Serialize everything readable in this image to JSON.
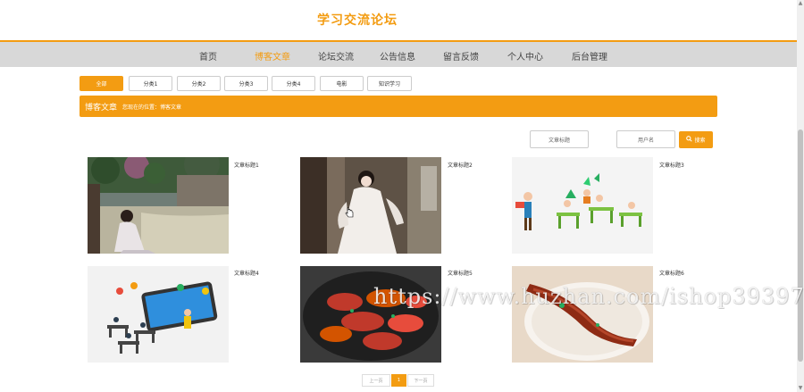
{
  "site": {
    "title": "学习交流论坛"
  },
  "nav": {
    "items": [
      {
        "label": "首页"
      },
      {
        "label": "博客文章"
      },
      {
        "label": "论坛交流"
      },
      {
        "label": "公告信息"
      },
      {
        "label": "留言反馈"
      },
      {
        "label": "个人中心"
      },
      {
        "label": "后台管理"
      }
    ],
    "active_index": 1
  },
  "categories": [
    "全部",
    "分类1",
    "分类2",
    "分类3",
    "分类4",
    "电影",
    "知识学习"
  ],
  "active_category": 0,
  "banner": {
    "title": "博客文章",
    "breadcrumb": "您现在的位置：博客文章"
  },
  "search": {
    "title_placeholder": "文章标题",
    "user_placeholder": "用户名",
    "button_label": "搜索"
  },
  "articles": [
    {
      "title": "文章标题1",
      "image": "woman-by-river-photo"
    },
    {
      "title": "文章标题2",
      "image": "woman-hanfu-photo"
    },
    {
      "title": "文章标题3",
      "image": "classroom-illustration"
    },
    {
      "title": "文章标题4",
      "image": "online-class-illustration"
    },
    {
      "title": "文章标题5",
      "image": "crayfish-photo"
    },
    {
      "title": "文章标题6",
      "image": "fish-dish-photo"
    }
  ],
  "pagination": {
    "prev": "上一页",
    "current": "1",
    "next": "下一页"
  },
  "watermark": "https://www.huzhan.com/ishop39397",
  "colors": {
    "accent": "#f39c12",
    "nav_bg": "#d8d8d8"
  }
}
